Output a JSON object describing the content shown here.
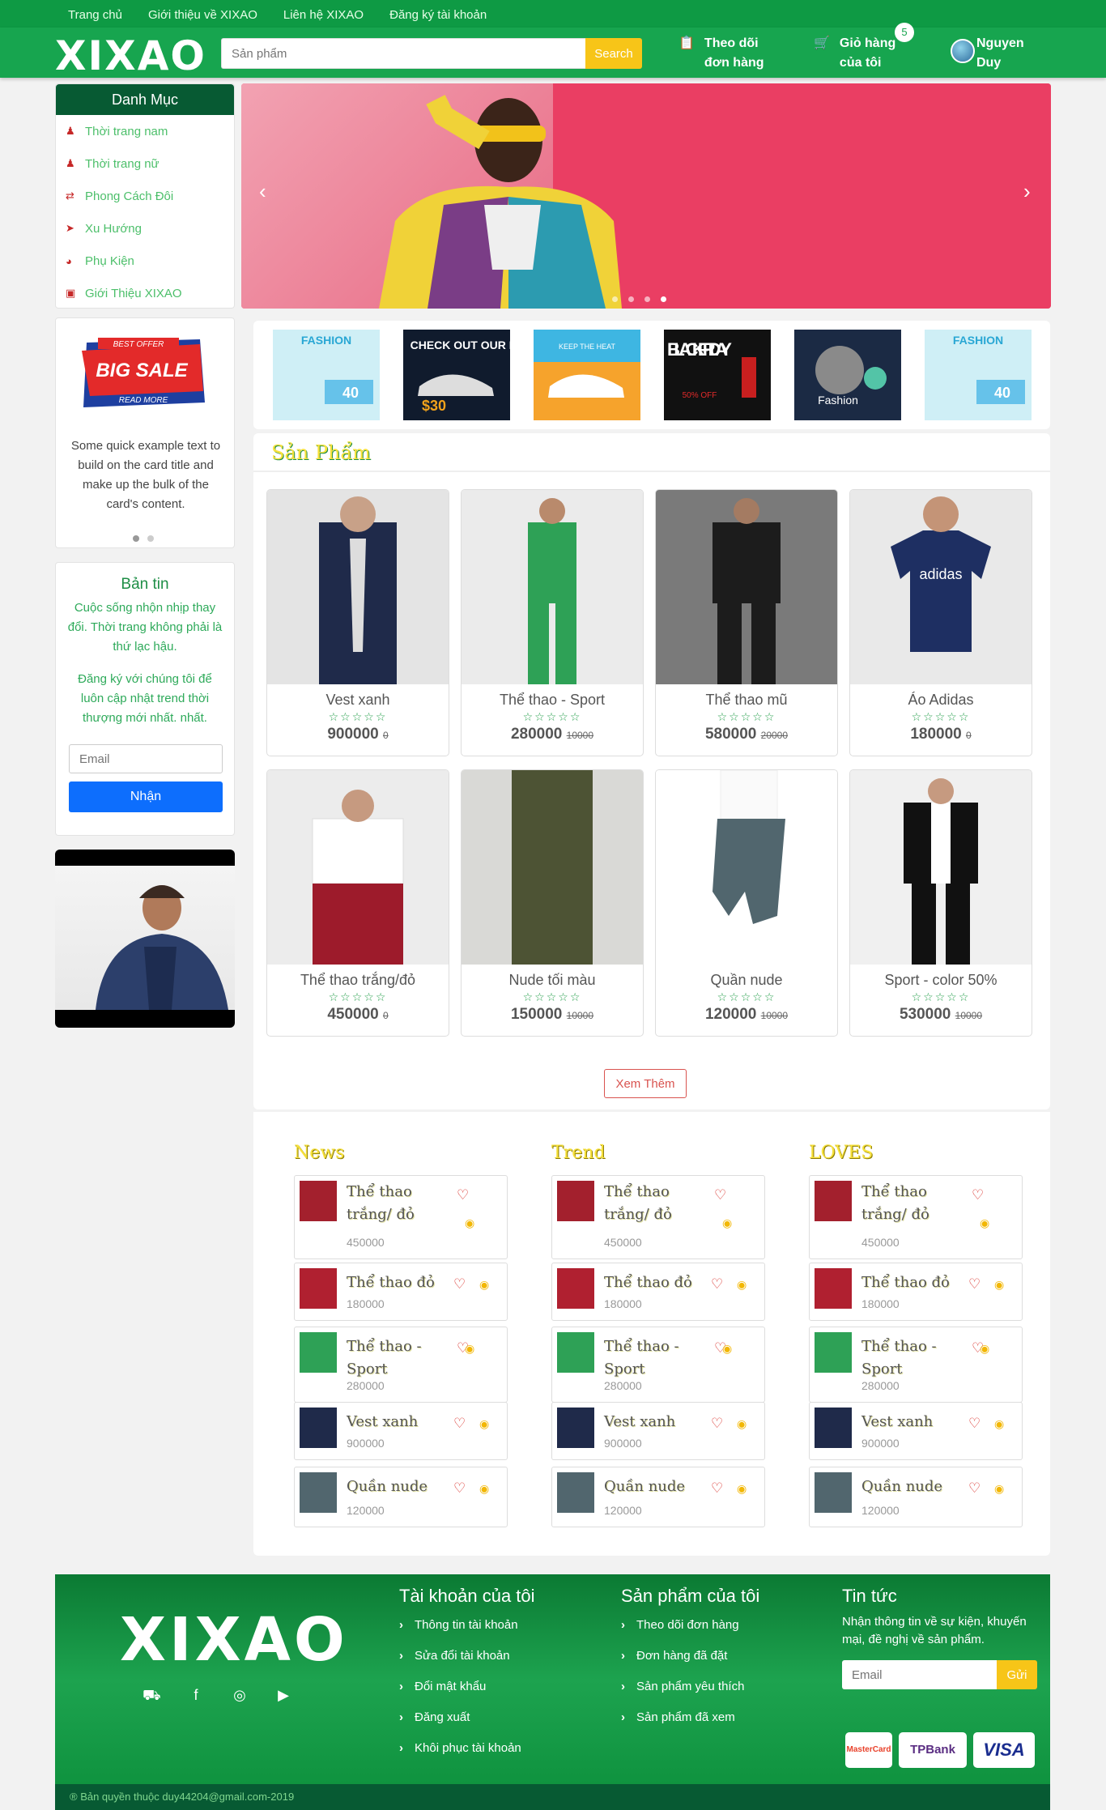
{
  "topnav": [
    "Trang chủ",
    "Giới thiệu về XIXAO",
    "Liên hệ XIXAO",
    "Đăng ký tài khoản"
  ],
  "logo": "XIXAO",
  "search": {
    "placeholder": "Sản phẩm",
    "button": "Search"
  },
  "header": {
    "track_order": "Theo dõi đơn hàng",
    "cart": "Giỏ hàng của tôi",
    "cart_count": "5",
    "user": "Nguyen Duy"
  },
  "categories": {
    "title": "Danh Mục",
    "items": [
      "Thời trang nam",
      "Thời trang nữ",
      "Phong Cách Đôi",
      "Xu Hướng",
      "Phụ Kiện",
      "Giới Thiệu XIXAO"
    ]
  },
  "sale_card": {
    "badge_top": "BEST OFFER",
    "badge_main": "BIG SALE",
    "badge_bottom": "READ MORE",
    "text": "Some quick example text to build on the card title and make up the bulk of the card's content."
  },
  "newsletter": {
    "title": "Bản tin",
    "line1": "Cuộc sống nhộn nhịp thay đổi. Thời trang không phải là thứ lạc hậu.",
    "line2": "Đăng ký với chúng tôi để luôn cập nhật trend thời thượng mới nhất. nhất.",
    "placeholder": "Email",
    "button": "Nhận"
  },
  "brand_tiles": [
    "FASHION",
    "CHECK OUT OUR NEW",
    "KEEP THE HEAT",
    "BLACK FRIDAY",
    "Fashion",
    "FASHION"
  ],
  "products": {
    "title": "Sản Phẩm",
    "more": "Xem Thêm",
    "items": [
      {
        "name": "Vest xanh",
        "price": "900000",
        "old": "0"
      },
      {
        "name": "Thể thao - Sport",
        "price": "280000",
        "old": "10000"
      },
      {
        "name": "Thể thao mũ",
        "price": "580000",
        "old": "20000"
      },
      {
        "name": "Áo Adidas",
        "price": "180000",
        "old": "0"
      },
      {
        "name": "Thể thao trắng/đỏ",
        "price": "450000",
        "old": "0"
      },
      {
        "name": "Nude tối màu",
        "price": "150000",
        "old": "10000"
      },
      {
        "name": "Quần nude",
        "price": "120000",
        "old": "10000"
      },
      {
        "name": "Sport - color 50%",
        "price": "530000",
        "old": "10000"
      }
    ]
  },
  "stars": "☆☆☆☆☆",
  "lists": [
    {
      "title": "News",
      "items": [
        {
          "name": "Thể thao trắng/ đỏ",
          "price": "450000"
        },
        {
          "name": "Thể thao đỏ",
          "price": "180000"
        },
        {
          "name": "Thể thao - Sport",
          "price": "280000"
        },
        {
          "name": "Vest xanh",
          "price": "900000"
        },
        {
          "name": "Quần nude",
          "price": "120000"
        }
      ]
    },
    {
      "title": "Trend",
      "items": [
        {
          "name": "Thể thao trắng/ đỏ",
          "price": "450000"
        },
        {
          "name": "Thể thao đỏ",
          "price": "180000"
        },
        {
          "name": "Thể thao - Sport",
          "price": "280000"
        },
        {
          "name": "Vest xanh",
          "price": "900000"
        },
        {
          "name": "Quần nude",
          "price": "120000"
        }
      ]
    },
    {
      "title": "LOVES",
      "items": [
        {
          "name": "Thể thao trắng/ đỏ",
          "price": "450000"
        },
        {
          "name": "Thể thao đỏ",
          "price": "180000"
        },
        {
          "name": "Thể thao - Sport",
          "price": "280000"
        },
        {
          "name": "Vest xanh",
          "price": "900000"
        },
        {
          "name": "Quần nude",
          "price": "120000"
        }
      ]
    }
  ],
  "footer": {
    "logo": "XIXAO",
    "account_title": "Tài khoản của tôi",
    "account_links": [
      "Thông tin tài khoản",
      "Sửa đổi tài khoản",
      "Đổi mật khẩu",
      "Đăng xuất",
      "Khôi phục tài khoản"
    ],
    "product_title": "Sản phẩm của tôi",
    "product_links": [
      "Theo dõi đơn hàng",
      "Đơn hàng đã đặt",
      "Sản phẩm yêu thích",
      "Sản phẩm đã xem"
    ],
    "news_title": "Tin tức",
    "news_text": "Nhận thông tin về sự kiện, khuyến mại, đề nghị về sản phẩm.",
    "email_placeholder": "Email",
    "send": "Gửi",
    "payments": [
      "MasterCard",
      "TPBank",
      "VISA"
    ],
    "copyright": "® Bản quyền thuộc duy44204@gmail.com-2019"
  },
  "colors": {
    "green": "#17a54f",
    "dark_green": "#075a33",
    "yellow": "#f7c518",
    "red": "#d9534f"
  }
}
